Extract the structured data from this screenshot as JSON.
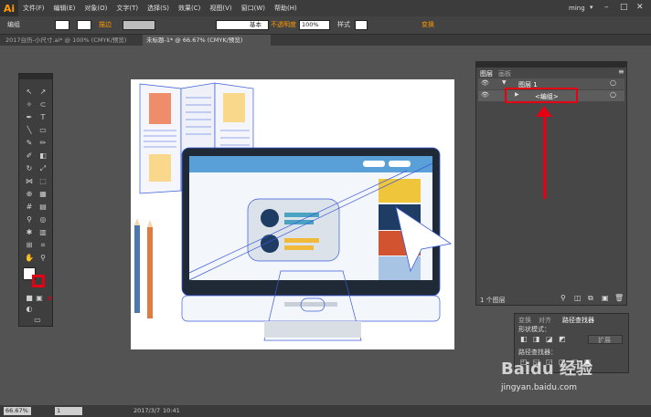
{
  "app": {
    "logo": "Ai",
    "user": "ming"
  },
  "menu": [
    "文件(F)",
    "编辑(E)",
    "对象(O)",
    "文字(T)",
    "选择(S)",
    "效果(C)",
    "视图(V)",
    "窗口(W)",
    "帮助(H)"
  ],
  "control": {
    "group_label": "编组",
    "stroke_label": "描边",
    "stroke_style": "基本",
    "opacity_label": "不透明度",
    "opacity_value": "100%",
    "style_label": "样式",
    "transform_label": "变换"
  },
  "tabs": [
    {
      "label": "2017台历-小尺寸.ai* @ 100% (CMYK/预览)"
    },
    {
      "label": "未标题-1* @ 66.67% (CMYK/预览)"
    }
  ],
  "layers_panel": {
    "tabs": [
      "图层",
      "画板"
    ],
    "layer_name": "图层 1",
    "sublayer_name": "<编组>",
    "footer_count": "1 个图层"
  },
  "pathfinder_panel": {
    "tabs": [
      "变换",
      "对齐",
      "路径查找器"
    ],
    "shape_modes_label": "形状模式：",
    "pathfinder_label": "路径查找器：",
    "expand_label": "扩展"
  },
  "status": {
    "zoom": "66.67%",
    "page": "1",
    "date": "2017/3/7",
    "time": "10:41"
  },
  "watermark": {
    "site": "jingyan.baidu.com",
    "brand": "Baidu 经验"
  },
  "colors": {
    "accent_orange": "#ff9a00",
    "selection_blue": "#3b5bdb",
    "highlight_red": "#e60012"
  }
}
